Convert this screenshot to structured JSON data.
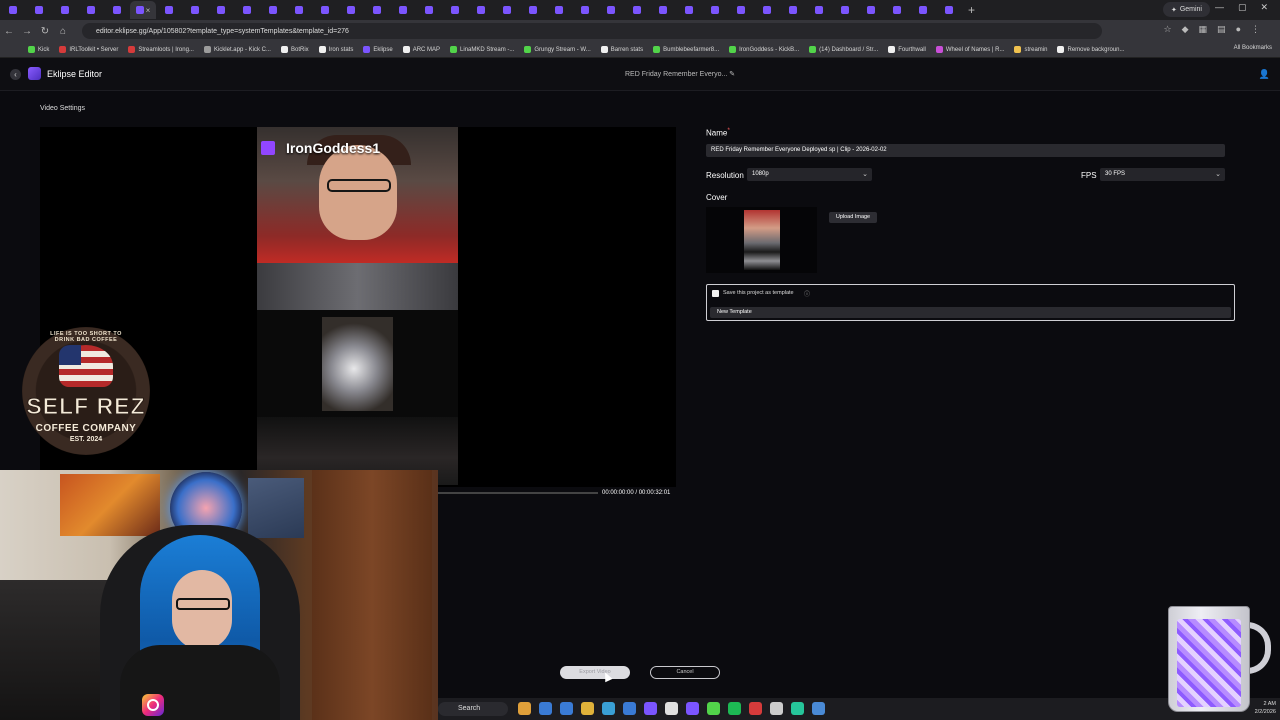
{
  "browser": {
    "tab_count": 37,
    "gemini_label": "Gemini",
    "url": "editor.eklipse.gg/App/105802?template_type=systemTemplates&template_id=276",
    "bookmarks": [
      "Kick",
      "IRLToolkit • Server",
      "Streamloots | Irong...",
      "Kicklet.app - Kick C...",
      "BotRix",
      "Iron stats",
      "Eklipse",
      "ARC MAP",
      "LinaMKD Stream -...",
      "Grungy Stream - W...",
      "Barren stats",
      "Bumblebeefarmer8...",
      "IronGoddess - KickB...",
      "(14) Dashboard / Str...",
      "Fourthwall",
      "Wheel of Names | R...",
      "streamin",
      "Remove backgroun..."
    ],
    "all_bookmarks": "All Bookmarks"
  },
  "app": {
    "title": "Eklipse Editor",
    "project_title": "RED Friday Remember Everyo..."
  },
  "video_settings_label": "Video Settings",
  "preview": {
    "streamer_name": "IronGoddess1",
    "timecode": "00:00:00:00 / 00:00:32:01"
  },
  "form": {
    "name_label": "Name",
    "required_mark": "*",
    "name_value": "RED Friday Remember Everyone Deployed sp | Clip - 2026-02-02",
    "resolution_label": "Resolution",
    "resolution_value": "1080p",
    "fps_label": "FPS",
    "fps_value": "30 FPS",
    "cover_label": "Cover",
    "upload_label": "Upload Image",
    "save_template_label": "Save this project as template",
    "template_name_value": "New Template"
  },
  "actions": {
    "export_label": "Export Video",
    "cancel_label": "Cancel"
  },
  "overlay": {
    "badge_arc": "LIFE IS TOO SHORT TO DRINK BAD COFFEE",
    "badge_main": "SELF REZ",
    "badge_sub": "COFFEE COMPANY",
    "badge_est": "EST. 2024"
  },
  "taskbar": {
    "search_label": "Search",
    "time": "2 AM",
    "date": "2/2/2026"
  }
}
